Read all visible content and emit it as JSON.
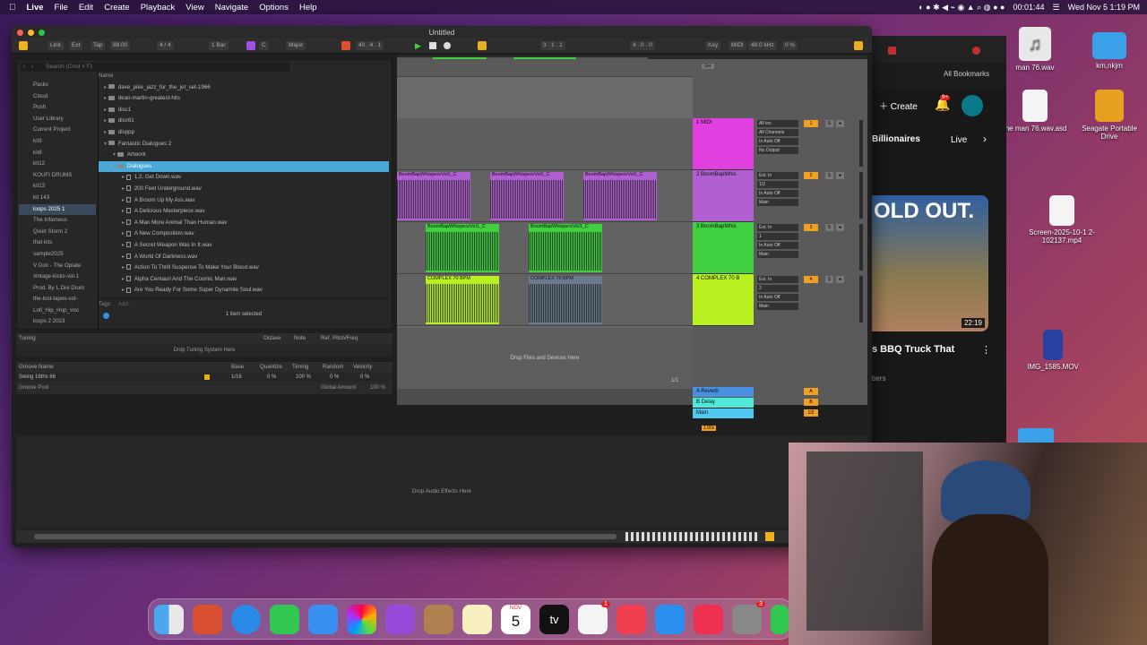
{
  "menubar": {
    "app": "Live",
    "items": [
      "File",
      "Edit",
      "Create",
      "Playback",
      "View",
      "Navigate",
      "Options",
      "Help"
    ],
    "time_code": "00:01:44",
    "date": "Wed Nov 5  1:19 PM"
  },
  "window": {
    "title": "Untitled"
  },
  "control": {
    "link": "Link",
    "ext": "Ext",
    "tap": "Tap",
    "tempo": "88.00",
    "sig": "4 / 4",
    "quant": "1 Bar",
    "key": "C",
    "scale": "Major",
    "pos": "40 . 4 . 1",
    "pos2": "3 . 1 . 1",
    "len": "4 . 0 . 0",
    "keylbl": "Key",
    "midilbl": "MIDI",
    "rate": "48.0 kHz",
    "cpu": "0 %"
  },
  "browser": {
    "search_placeholder": "Search (Cmd + F)",
    "name_header": "Name",
    "places": [
      "Packs",
      "Cloud",
      "Push",
      "User Library",
      "Current Project",
      "kit9",
      "kit8",
      "kit12",
      "KOUFI DRUMS",
      "kit13",
      "kit 143",
      "loops 2025 1",
      "The Infamous",
      "Quiet Storm 2",
      "that kits",
      "sample2025",
      "V Don - The Opiate",
      "vintage-kicks-vol-1",
      "Prod. By L.Dre Drum",
      "the-lost-tapes-vol-",
      "Lofi_Hip_Hop_Voc",
      "loops 2 2023"
    ],
    "selected_place": "loops 2025 1",
    "tree": [
      {
        "t": "folder",
        "l": "dave_pike_jazz_for_the_jet_set-1966",
        "d": 0
      },
      {
        "t": "folder",
        "l": "dean-martin-greatest-hits",
        "d": 0
      },
      {
        "t": "folder",
        "l": "disc1",
        "d": 0
      },
      {
        "t": "folder",
        "l": "disc61",
        "d": 0
      },
      {
        "t": "folder",
        "l": "disppp",
        "d": 0
      },
      {
        "t": "folder",
        "l": "Fantastic Dialogues 2",
        "d": 0
      },
      {
        "t": "folder",
        "l": "Artwork",
        "d": 1
      },
      {
        "t": "folder",
        "l": "Dialogues",
        "d": 1,
        "sel": true
      },
      {
        "t": "file",
        "l": "1,2, Get Down.wav",
        "d": 2
      },
      {
        "t": "file",
        "l": "200 Feet Underground.wav",
        "d": 2
      },
      {
        "t": "file",
        "l": "A Broom Up My Ass.wav",
        "d": 2
      },
      {
        "t": "file",
        "l": "A Delicious Masterpiece.wav",
        "d": 2
      },
      {
        "t": "file",
        "l": "A Man More Animal Than Human.wav",
        "d": 2
      },
      {
        "t": "file",
        "l": "A New Composition.wav",
        "d": 2
      },
      {
        "t": "file",
        "l": "A Secret Weapon Was In It.wav",
        "d": 2
      },
      {
        "t": "file",
        "l": "A World Of Darkness.wav",
        "d": 2
      },
      {
        "t": "file",
        "l": "Action To Thrill Suspense To Make Your Blood.wav",
        "d": 2
      },
      {
        "t": "file",
        "l": "Alpha Centauri And The Cosmic Man.wav",
        "d": 2
      },
      {
        "t": "file",
        "l": "Are You Ready For Some Super Dynamite Soul.wav",
        "d": 2
      }
    ],
    "tags": "Tags:",
    "add": "Add...",
    "status": "1 item selected"
  },
  "tuning": {
    "title": "Tuning",
    "octave": "Octave",
    "note": "Note",
    "ref": "Ref. Pitch/Freq",
    "drop": "Drop Tuning System Here"
  },
  "groove": {
    "cols": [
      "Groove Name",
      "Base",
      "Quantize",
      "Timing",
      "Random",
      "Velocity"
    ],
    "row": "Swing 16ths 66",
    "base": "1/16",
    "q": "0 %",
    "timing": "100 %",
    "random": "0 %",
    "vel": "0 %",
    "pool": "Groove Pool",
    "amount_label": "Global Amount",
    "amount": "100 %"
  },
  "arrangement": {
    "ruler": [
      "1",
      "5",
      "9",
      "13",
      "17",
      "21",
      "25",
      "29"
    ],
    "drop": "Drop Files and Devices Here",
    "time_ruler": [
      "0:00",
      "0:15",
      "0:30",
      "0:45",
      "1:00",
      "1:15"
    ],
    "clips": [
      {
        "track": 1,
        "name": "BoomBapWhispersVol1_C"
      },
      {
        "track": 1,
        "name": "BoomBapWhispersVol1_C"
      },
      {
        "track": 1,
        "name": "BoomBapWhispersVol1_C"
      },
      {
        "track": 2,
        "name": "BoomBapWhispersVol1_C"
      },
      {
        "track": 2,
        "name": "BoomBapWhispersVol1_C"
      },
      {
        "track": 3,
        "name": "COMPLEX 70 BPM"
      },
      {
        "track": 3,
        "name": "COMPLEX 70 BPM"
      }
    ]
  },
  "tracks": [
    {
      "name": "1 MIDI",
      "color": "#e040e0",
      "in": "All Ins",
      "ch": "All Channels",
      "mon": "In Auto Off",
      "out": "No Output",
      "num": "1"
    },
    {
      "name": "2 BoomBapWhis",
      "color": "#b060d0",
      "in": "Ext. In",
      "ch": "1/2",
      "mon": "In Auto Off",
      "out": "Main",
      "num": "2"
    },
    {
      "name": "3 BoomBapWhis",
      "color": "#40d040",
      "in": "Ext. In",
      "ch": "1",
      "mon": "In Auto Off",
      "out": "Main",
      "num": "3"
    },
    {
      "name": "4 COMPLEX 70 B",
      "color": "#b8f020",
      "in": "Ext. In",
      "ch": "2",
      "mon": "In Auto Off",
      "out": "Main",
      "num": "4"
    }
  ],
  "returns": [
    {
      "name": "A Reverb",
      "num": "A"
    },
    {
      "name": "B Delay",
      "num": "B"
    },
    {
      "name": "Main",
      "num": "1/2"
    }
  ],
  "master_zoom": "1.00x",
  "set_label": "Set",
  "device_drop": "Drop Audio Effects Here",
  "loop_ratio": "1/1",
  "desktop": [
    {
      "label": "man 76.wav"
    },
    {
      "label": "km,nkjm"
    },
    {
      "label": "the man 76.wav.asd"
    },
    {
      "label": "Seagate Portable Drive"
    },
    {
      "label": "Screen-2025-10-1 2-102137.mp4"
    },
    {
      "label": "IMG_1585.MOV"
    }
  ],
  "youtube": {
    "create": "Create",
    "badge": "9+",
    "bookmarks": "All Bookmarks",
    "chip1": "Billionaires",
    "chip2": "Live",
    "thumb_text": "OLD OUT.",
    "duration": "22:19",
    "video_title": "s BBQ Truck That",
    "sub": "bers"
  },
  "dock": {
    "cal_month": "NOV",
    "cal_day": "5",
    "tv": "tv",
    "badge1": "1",
    "badge2": "3"
  }
}
